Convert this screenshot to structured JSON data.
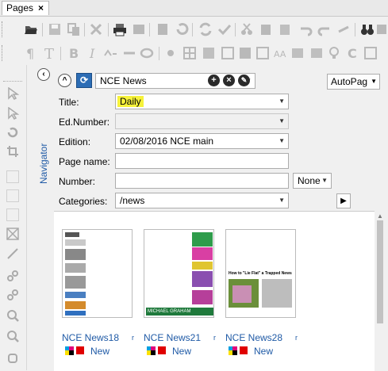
{
  "tab": {
    "title": "Pages",
    "close": "×"
  },
  "navigator": {
    "label": "Navigator",
    "collapse_glyph": "‹"
  },
  "header": {
    "publication": "NCE News",
    "autopag": "AutoPag",
    "up_glyph": "^",
    "refresh_glyph": "⟳",
    "add_glyph": "+",
    "remove_glyph": "×",
    "edit_glyph": "✎"
  },
  "form": {
    "title_label": "Title:",
    "title_value": "Daily",
    "ednumber_label": "Ed.Number:",
    "ednumber_value": "",
    "edition_label": "Edition:",
    "edition_value": "02/08/2016 NCE main",
    "pagename_label": "Page name:",
    "pagename_value": "",
    "number_label": "Number:",
    "number_value": "",
    "number_mode": "None",
    "categories_label": "Categories:",
    "categories_value": "/news",
    "play_glyph": "▶"
  },
  "pages": [
    {
      "name": "NCE News18",
      "status": "New"
    },
    {
      "name": "NCE News21",
      "status": "New"
    },
    {
      "name": "NCE News28",
      "status": "New"
    }
  ],
  "page_art": {
    "p2_footer": "MICHAEL GRAHAM",
    "p3_headline": "How to \"Lie Flat\" a Trapped News"
  },
  "colors": {
    "highlight": "#f6f23a",
    "link": "#1f5aa6",
    "status_red": "#e00000",
    "refresh_blue": "#2c6db5"
  }
}
